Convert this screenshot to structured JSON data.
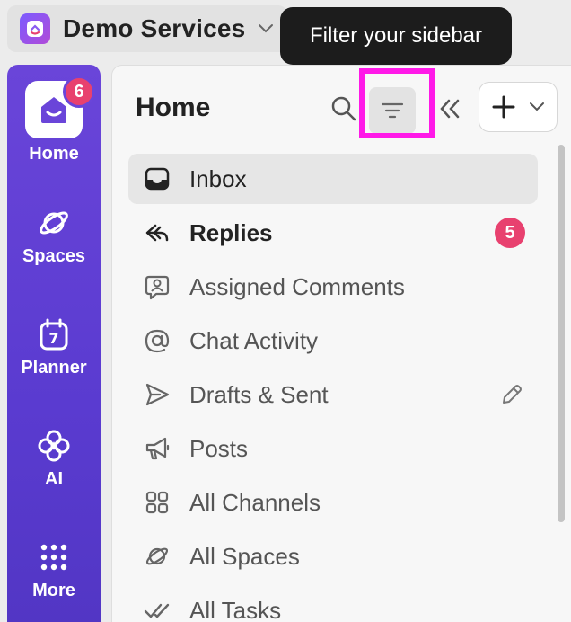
{
  "workspace": {
    "name": "Demo Services",
    "icon": "workspace-logo-icon"
  },
  "tooltip": {
    "text": "Filter your sidebar"
  },
  "rail": {
    "home_badge": "6",
    "items": [
      {
        "label": "Home",
        "icon": "home-icon"
      },
      {
        "label": "Spaces",
        "icon": "planet-icon"
      },
      {
        "label": "Planner",
        "icon": "calendar-icon",
        "day": "7"
      },
      {
        "label": "AI",
        "icon": "ai-sparkle-icon"
      },
      {
        "label": "More",
        "icon": "grid-dots-icon"
      }
    ]
  },
  "panel": {
    "title": "Home",
    "items": [
      {
        "label": "Inbox",
        "icon": "inbox-icon",
        "active": true
      },
      {
        "label": "Replies",
        "icon": "reply-icon",
        "bold": true,
        "badge": "5"
      },
      {
        "label": "Assigned Comments",
        "icon": "comment-user-icon"
      },
      {
        "label": "Chat Activity",
        "icon": "at-icon"
      },
      {
        "label": "Drafts & Sent",
        "icon": "send-icon",
        "trailing": "pencil-icon"
      },
      {
        "label": "Posts",
        "icon": "megaphone-icon"
      },
      {
        "label": "All Channels",
        "icon": "channels-grid-icon"
      },
      {
        "label": "All Spaces",
        "icon": "planet-icon"
      },
      {
        "label": "All Tasks",
        "icon": "double-check-icon"
      }
    ]
  },
  "colors": {
    "rail": "#6a45d9",
    "badge": "#e8416f",
    "highlight": "#ff19e8",
    "tooltip": "#1c1c1c"
  }
}
